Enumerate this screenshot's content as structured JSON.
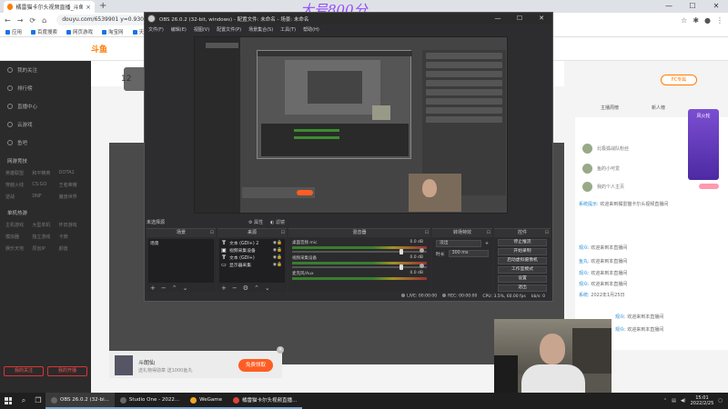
{
  "browser": {
    "tab_title": "橘雷猫卡尔头视频直播_斗鱼直播间",
    "new_tab": "+",
    "url": "douyu.com/6539901 y=0.9307",
    "bookmarks": [
      "应用",
      "百度搜索",
      "网页游戏",
      "淘宝网",
      "天猫"
    ],
    "win_min": "—",
    "win_max": "☐",
    "win_close": "✕",
    "back": "←",
    "forward": "→",
    "reload": "⟳",
    "home": "⌂"
  },
  "watermark": "大号800分",
  "douyu": {
    "logo": "斗鱼",
    "follow_count": "12",
    "sidebar_items": [
      "我的关注",
      "排行榜",
      "直播中心",
      "云游戏",
      "鱼吧"
    ],
    "sidebar_head1": "网游竞技",
    "sidebar_grid1": [
      "英雄联盟",
      "和平精英",
      "DOTA2",
      "穿越火线",
      "CS:GO",
      "王者荣耀",
      "逆战",
      "DNF",
      "魔兽世界"
    ],
    "sidebar_head2": "单机热游",
    "sidebar_grid2": [
      "主机游戏",
      "大型单机",
      "怀旧游戏",
      "模拟器",
      "独立游戏",
      "卡牌",
      "娱乐天地",
      "原创IP",
      "颜值"
    ],
    "sidebar_btn1": "我的关注",
    "sidebar_btn2": "我的开播",
    "fc_button": "FC专属",
    "rank_tabs": [
      "主播周榜",
      "新人榜"
    ],
    "rank_rows": [
      "北极狐战队粉丝",
      "鱼的小可爱",
      "我的个人主页"
    ],
    "badge_text": "风火轮",
    "chat_lines": [
      {
        "name": "系统提示:",
        "text": "欢迎来到橘雷猫卡尔头视频直播间"
      },
      {
        "name": "观众:",
        "text": "欢迎来到本直播间"
      },
      {
        "name": "鱼丸:",
        "text": "欢迎来到本直播间"
      },
      {
        "name": "观众:",
        "text": "欢迎来到本直播间"
      },
      {
        "name": "观众:",
        "text": "欢迎来到本直播间"
      },
      {
        "name": "系统:",
        "text": "2022年1月25日"
      },
      {
        "name": "观众:",
        "text": "欢迎来到本直播间"
      },
      {
        "name": "观众:",
        "text": "欢迎来到本直播间"
      }
    ],
    "gift_name": "斗朗仙",
    "gift_sub": "送礼物得勋章 送1000鱼丸",
    "gift_button": "免费领取",
    "gift_close": "×"
  },
  "obs": {
    "title": "OBS 26.0.2 (32-bit, windows) - 配置文件: 未命名 - 场景: 未命名",
    "menu": [
      "文件(F)",
      "编辑(E)",
      "视图(V)",
      "配置文件(P)",
      "场景集合(S)",
      "工具(T)",
      "帮助(H)"
    ],
    "preview_label": "",
    "scene_label": "未选择源",
    "filter_label": "属性",
    "filter_label2": "滤镜",
    "docks": {
      "scenes": "场景",
      "sources": "来源",
      "mixer": "混音器",
      "transitions": "转场特效",
      "controls": "控件"
    },
    "scene_items": [
      "场景"
    ],
    "source_items": [
      {
        "icon": "T",
        "label": "文本 (GDI+) 2"
      },
      {
        "icon": "▣",
        "label": "视频采集设备"
      },
      {
        "icon": "T",
        "label": "文本 (GDI+)"
      },
      {
        "icon": "▭",
        "label": "显示器采集"
      }
    ],
    "mixer_tracks": [
      {
        "name": "桌面音频 mic",
        "db": "0.0 dB"
      },
      {
        "name": "视频采集设备",
        "db": "0.0 dB"
      },
      {
        "name": "麦克风/Aux",
        "db": "0.0 dB"
      }
    ],
    "transition_select": "淡出",
    "duration_label": "时长",
    "duration_value": "300 ms",
    "controls": [
      "停止推流",
      "开始录制",
      "启动虚拟摄像机",
      "工作室模式",
      "设置",
      "退出"
    ],
    "status": {
      "live": "LIVE: 00:00:00",
      "rec": "REC: 00:00:00",
      "cpu": "CPU: 3.5%, 60.00 fps",
      "drop": "kb/s: 0"
    },
    "min": "—",
    "max": "☐",
    "close": "✕"
  },
  "taskbar": {
    "apps": [
      "OBS 26.0.2 (32-bi...",
      "Studio One - 2022...",
      "WeGame",
      "橘雷猫卡尔头视频直播..."
    ],
    "time": "15:01",
    "date": "2022/2/25"
  },
  "colors": {
    "douyu_orange": "#ff7a00",
    "obs_bg": "#2d2d30",
    "taskbar": "#1f1f1f"
  }
}
